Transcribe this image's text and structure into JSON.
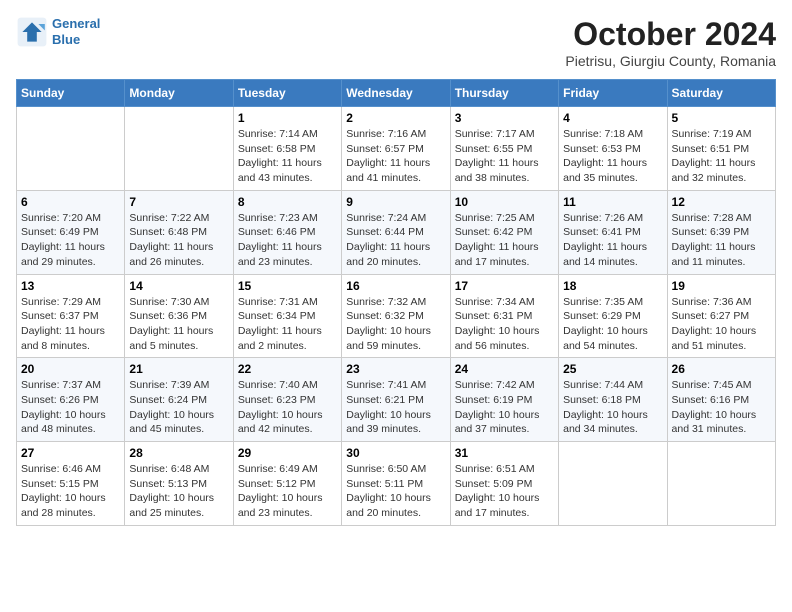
{
  "header": {
    "logo_line1": "General",
    "logo_line2": "Blue",
    "month": "October 2024",
    "location": "Pietrisu, Giurgiu County, Romania"
  },
  "weekdays": [
    "Sunday",
    "Monday",
    "Tuesday",
    "Wednesday",
    "Thursday",
    "Friday",
    "Saturday"
  ],
  "weeks": [
    [
      {
        "day": "",
        "info": ""
      },
      {
        "day": "",
        "info": ""
      },
      {
        "day": "1",
        "info": "Sunrise: 7:14 AM\nSunset: 6:58 PM\nDaylight: 11 hours and 43 minutes."
      },
      {
        "day": "2",
        "info": "Sunrise: 7:16 AM\nSunset: 6:57 PM\nDaylight: 11 hours and 41 minutes."
      },
      {
        "day": "3",
        "info": "Sunrise: 7:17 AM\nSunset: 6:55 PM\nDaylight: 11 hours and 38 minutes."
      },
      {
        "day": "4",
        "info": "Sunrise: 7:18 AM\nSunset: 6:53 PM\nDaylight: 11 hours and 35 minutes."
      },
      {
        "day": "5",
        "info": "Sunrise: 7:19 AM\nSunset: 6:51 PM\nDaylight: 11 hours and 32 minutes."
      }
    ],
    [
      {
        "day": "6",
        "info": "Sunrise: 7:20 AM\nSunset: 6:49 PM\nDaylight: 11 hours and 29 minutes."
      },
      {
        "day": "7",
        "info": "Sunrise: 7:22 AM\nSunset: 6:48 PM\nDaylight: 11 hours and 26 minutes."
      },
      {
        "day": "8",
        "info": "Sunrise: 7:23 AM\nSunset: 6:46 PM\nDaylight: 11 hours and 23 minutes."
      },
      {
        "day": "9",
        "info": "Sunrise: 7:24 AM\nSunset: 6:44 PM\nDaylight: 11 hours and 20 minutes."
      },
      {
        "day": "10",
        "info": "Sunrise: 7:25 AM\nSunset: 6:42 PM\nDaylight: 11 hours and 17 minutes."
      },
      {
        "day": "11",
        "info": "Sunrise: 7:26 AM\nSunset: 6:41 PM\nDaylight: 11 hours and 14 minutes."
      },
      {
        "day": "12",
        "info": "Sunrise: 7:28 AM\nSunset: 6:39 PM\nDaylight: 11 hours and 11 minutes."
      }
    ],
    [
      {
        "day": "13",
        "info": "Sunrise: 7:29 AM\nSunset: 6:37 PM\nDaylight: 11 hours and 8 minutes."
      },
      {
        "day": "14",
        "info": "Sunrise: 7:30 AM\nSunset: 6:36 PM\nDaylight: 11 hours and 5 minutes."
      },
      {
        "day": "15",
        "info": "Sunrise: 7:31 AM\nSunset: 6:34 PM\nDaylight: 11 hours and 2 minutes."
      },
      {
        "day": "16",
        "info": "Sunrise: 7:32 AM\nSunset: 6:32 PM\nDaylight: 10 hours and 59 minutes."
      },
      {
        "day": "17",
        "info": "Sunrise: 7:34 AM\nSunset: 6:31 PM\nDaylight: 10 hours and 56 minutes."
      },
      {
        "day": "18",
        "info": "Sunrise: 7:35 AM\nSunset: 6:29 PM\nDaylight: 10 hours and 54 minutes."
      },
      {
        "day": "19",
        "info": "Sunrise: 7:36 AM\nSunset: 6:27 PM\nDaylight: 10 hours and 51 minutes."
      }
    ],
    [
      {
        "day": "20",
        "info": "Sunrise: 7:37 AM\nSunset: 6:26 PM\nDaylight: 10 hours and 48 minutes."
      },
      {
        "day": "21",
        "info": "Sunrise: 7:39 AM\nSunset: 6:24 PM\nDaylight: 10 hours and 45 minutes."
      },
      {
        "day": "22",
        "info": "Sunrise: 7:40 AM\nSunset: 6:23 PM\nDaylight: 10 hours and 42 minutes."
      },
      {
        "day": "23",
        "info": "Sunrise: 7:41 AM\nSunset: 6:21 PM\nDaylight: 10 hours and 39 minutes."
      },
      {
        "day": "24",
        "info": "Sunrise: 7:42 AM\nSunset: 6:19 PM\nDaylight: 10 hours and 37 minutes."
      },
      {
        "day": "25",
        "info": "Sunrise: 7:44 AM\nSunset: 6:18 PM\nDaylight: 10 hours and 34 minutes."
      },
      {
        "day": "26",
        "info": "Sunrise: 7:45 AM\nSunset: 6:16 PM\nDaylight: 10 hours and 31 minutes."
      }
    ],
    [
      {
        "day": "27",
        "info": "Sunrise: 6:46 AM\nSunset: 5:15 PM\nDaylight: 10 hours and 28 minutes."
      },
      {
        "day": "28",
        "info": "Sunrise: 6:48 AM\nSunset: 5:13 PM\nDaylight: 10 hours and 25 minutes."
      },
      {
        "day": "29",
        "info": "Sunrise: 6:49 AM\nSunset: 5:12 PM\nDaylight: 10 hours and 23 minutes."
      },
      {
        "day": "30",
        "info": "Sunrise: 6:50 AM\nSunset: 5:11 PM\nDaylight: 10 hours and 20 minutes."
      },
      {
        "day": "31",
        "info": "Sunrise: 6:51 AM\nSunset: 5:09 PM\nDaylight: 10 hours and 17 minutes."
      },
      {
        "day": "",
        "info": ""
      },
      {
        "day": "",
        "info": ""
      }
    ]
  ]
}
